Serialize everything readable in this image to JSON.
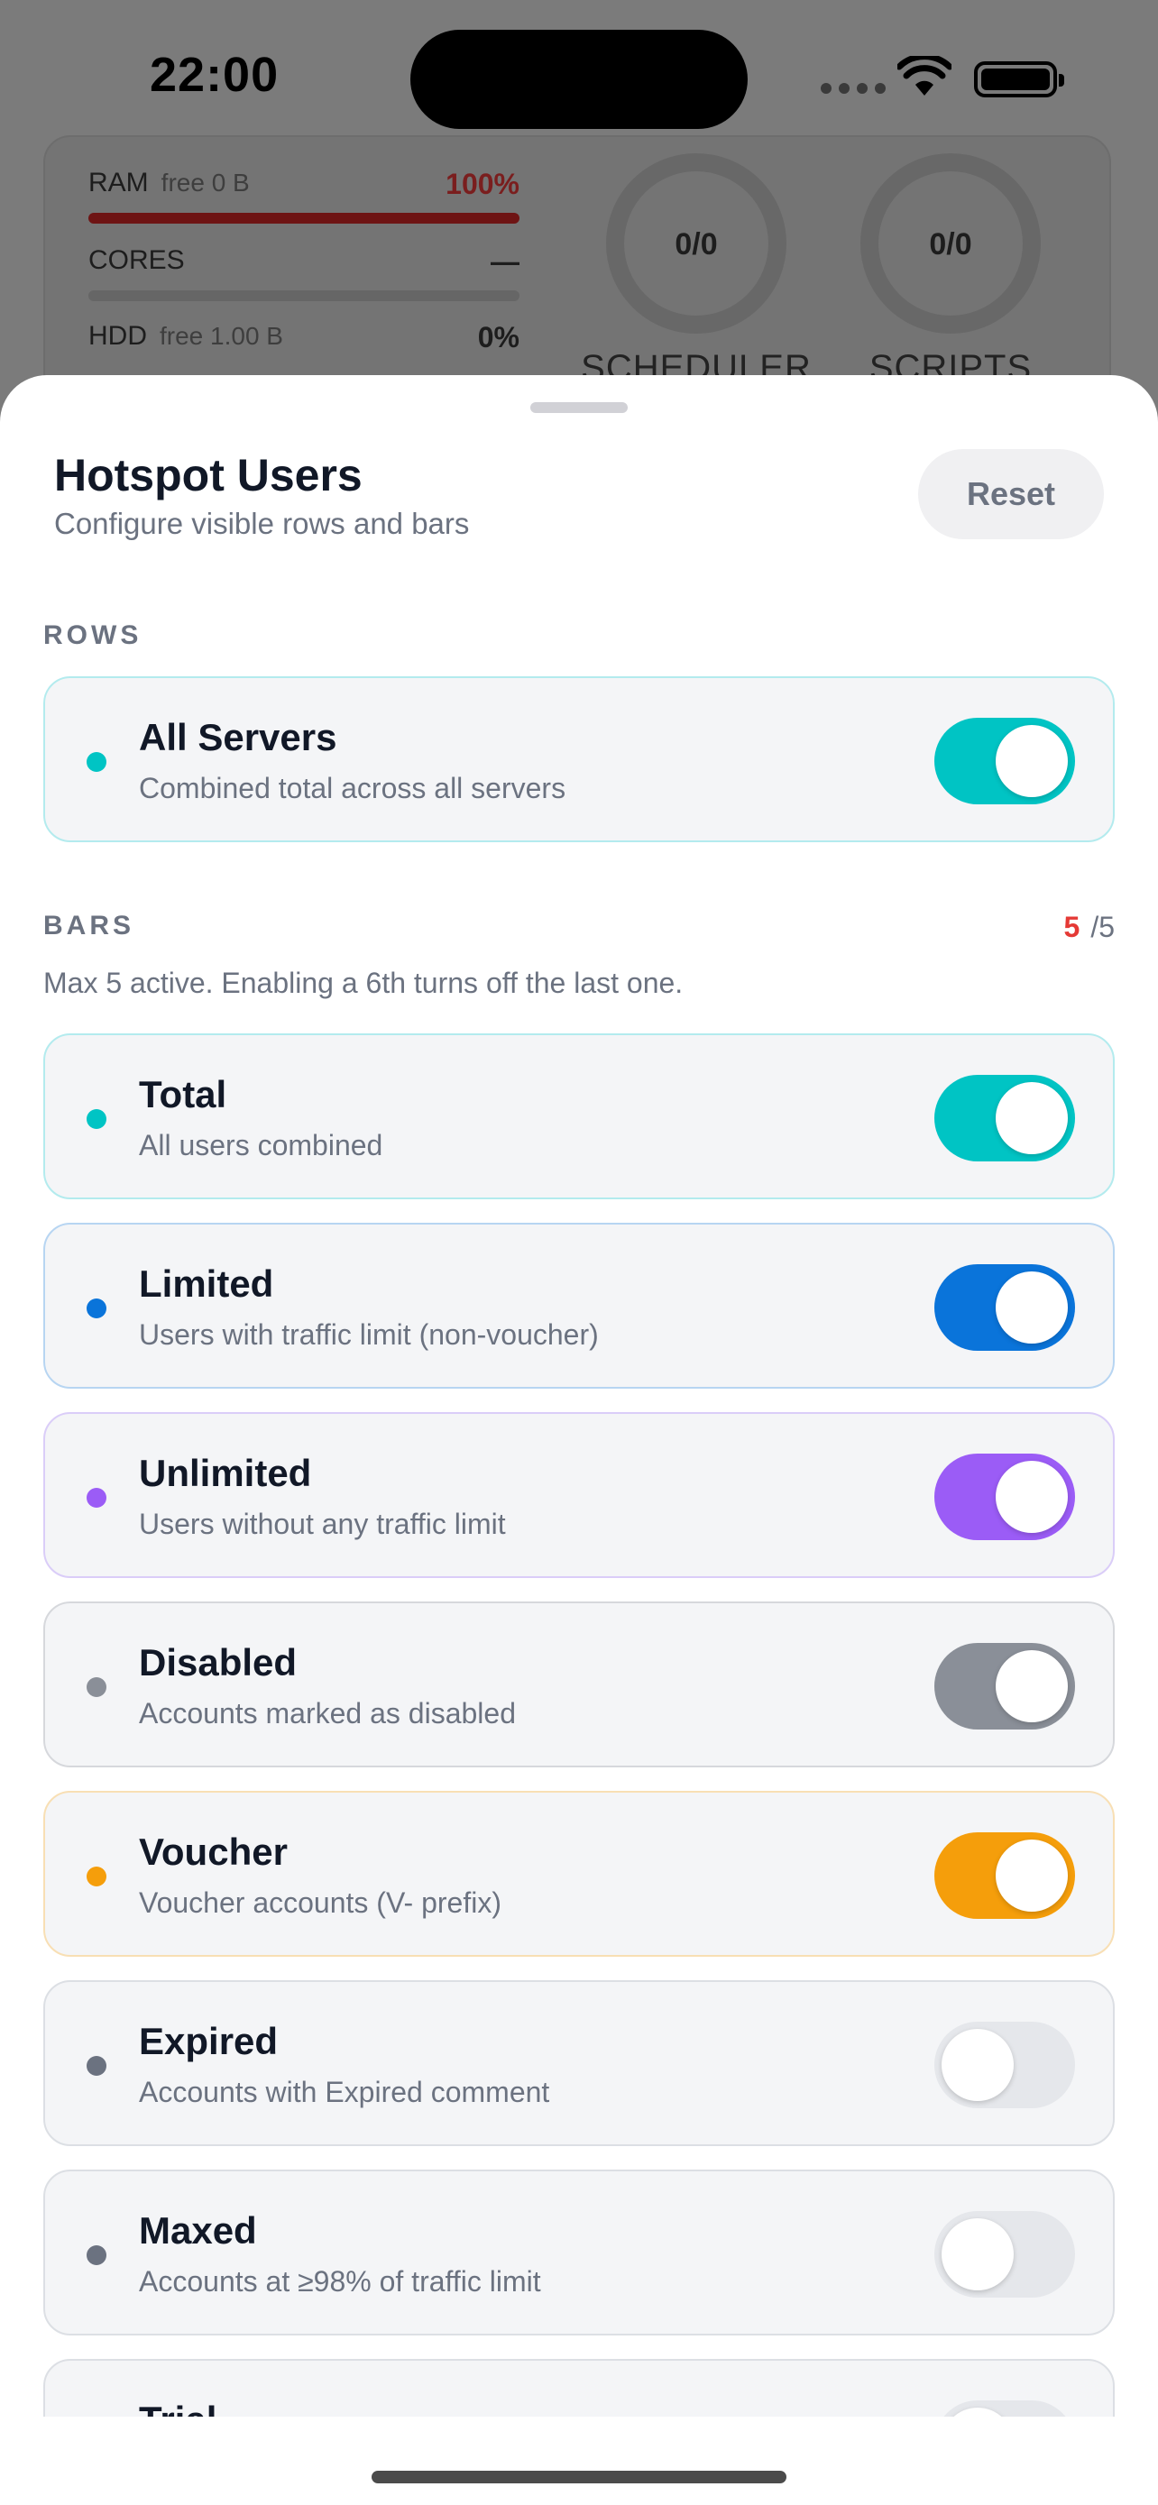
{
  "status": {
    "time": "22:00"
  },
  "background": {
    "resources": [
      {
        "label": "RAM",
        "sub": "free 0 B",
        "value": "100%",
        "fill": 1.0
      },
      {
        "label": "CORES",
        "sub": "",
        "value": "—",
        "fill": 0
      },
      {
        "label": "HDD",
        "sub": "free 1.00 B",
        "value": "0%",
        "fill": 0
      }
    ],
    "rings": [
      {
        "value": "0/0",
        "label": "SCHEDULER"
      },
      {
        "value": "0/0",
        "label": "SCRIPTS"
      }
    ]
  },
  "sheet": {
    "title": "Hotspot Users",
    "subtitle": "Configure visible rows and bars",
    "reset_label": "Reset",
    "rows_label": "ROWS",
    "rows": [
      {
        "title": "All Servers",
        "desc": "Combined total across all servers",
        "on": true,
        "color": "#00c4c4"
      }
    ],
    "bars_label": "BARS",
    "bars_active": "5",
    "bars_max": "/5",
    "bars_hint": "Max 5 active. Enabling a 6th turns off the last one.",
    "bars": [
      {
        "title": "Total",
        "desc": "All users combined",
        "on": true,
        "color": "#00c4c4",
        "border": "#b3ebee"
      },
      {
        "title": "Limited",
        "desc": "Users with traffic limit (non-voucher)",
        "on": true,
        "color": "#0a74da",
        "border": "#b7d5f2"
      },
      {
        "title": "Unlimited",
        "desc": "Users without any traffic limit",
        "on": true,
        "color": "#9b5cf6",
        "border": "#dacdf8"
      },
      {
        "title": "Disabled",
        "desc": "Accounts marked as disabled",
        "on": true,
        "color": "#8a8f98",
        "border": "#d6d8dc"
      },
      {
        "title": "Voucher",
        "desc": "Voucher accounts (V- prefix)",
        "on": true,
        "color": "#f59e0b",
        "border": "#f8dfb4"
      },
      {
        "title": "Expired",
        "desc": "Accounts with Expired comment",
        "on": false,
        "color": "#6b7280",
        "border": "#dcdfe4"
      },
      {
        "title": "Maxed",
        "desc": "Accounts at ≥98% of traffic limit",
        "on": false,
        "color": "#6b7280",
        "border": "#dcdfe4"
      },
      {
        "title": "Trial",
        "desc": "",
        "on": false,
        "color": "#6b7280",
        "border": "#dcdfe4"
      }
    ]
  }
}
